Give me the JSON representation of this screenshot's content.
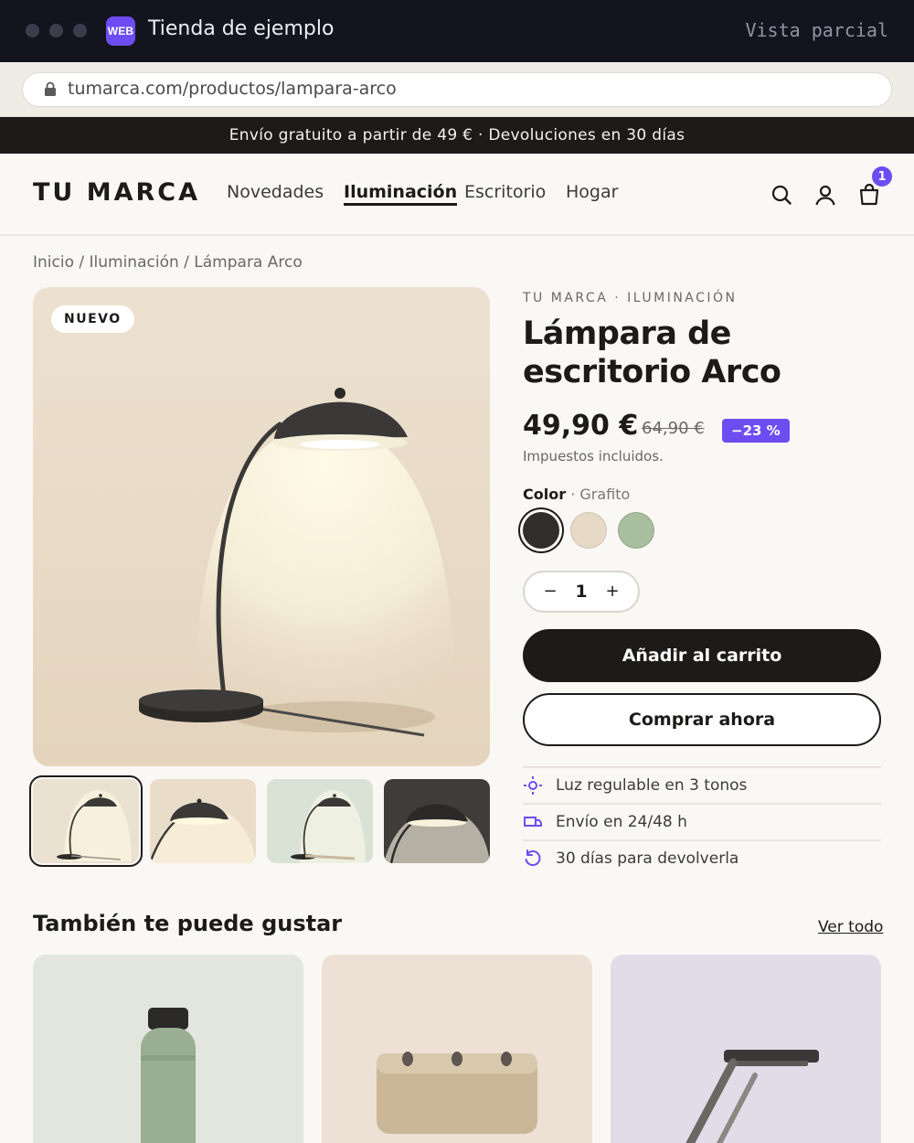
{
  "window": {
    "badge": "WEB",
    "title": "Tienda de ejemplo",
    "mode": "Vista parcial"
  },
  "browser": {
    "url": "tumarca.com/productos/lampara-arco"
  },
  "promo": {
    "text": "Envío gratuito a partir de 49 € · Devoluciones en 30 días"
  },
  "header": {
    "logo": "TU MARCA",
    "nav": [
      "Novedades",
      "Iluminación",
      "Escritorio",
      "Hogar"
    ],
    "active_nav": "Iluminación",
    "cart_count": "1"
  },
  "breadcrumb": "Inicio / Iluminación / Lámpara Arco",
  "gallery": {
    "badge": "NUEVO",
    "thumbnail_count": 4,
    "selected_thumbnail": 1
  },
  "product": {
    "brand_line": "TU MARCA · ILUMINACIÓN",
    "title": "Lámpara de escritorio Arco",
    "price": "49,90 €",
    "old_price": "64,90 €",
    "discount": "−23 %",
    "tax_note": "Impuestos incluidos.",
    "color_label": "Color",
    "color_selected": "Grafito",
    "swatches": [
      {
        "name": "grafito",
        "color": "#2f2e2c"
      },
      {
        "name": "arena",
        "color": "#e6d9c6"
      },
      {
        "name": "salvia",
        "color": "#a9bd9f"
      }
    ],
    "qty_minus": "−",
    "quantity": "1",
    "qty_plus": "+",
    "add_to_cart": "Añadir al carrito",
    "buy_now": "Comprar ahora",
    "features": [
      {
        "icon": "dimmer-icon",
        "text": "Luz regulable en 3 tonos"
      },
      {
        "icon": "truck-icon",
        "text": "Envío en 24/48 h"
      },
      {
        "icon": "return-icon",
        "text": "30 días para devolverla"
      }
    ]
  },
  "related": {
    "title": "También te puede gustar",
    "see_all": "Ver todo"
  },
  "colors": {
    "accent": "#6d4df2",
    "dark": "#1c1b1a",
    "background": "#faf8f4"
  }
}
